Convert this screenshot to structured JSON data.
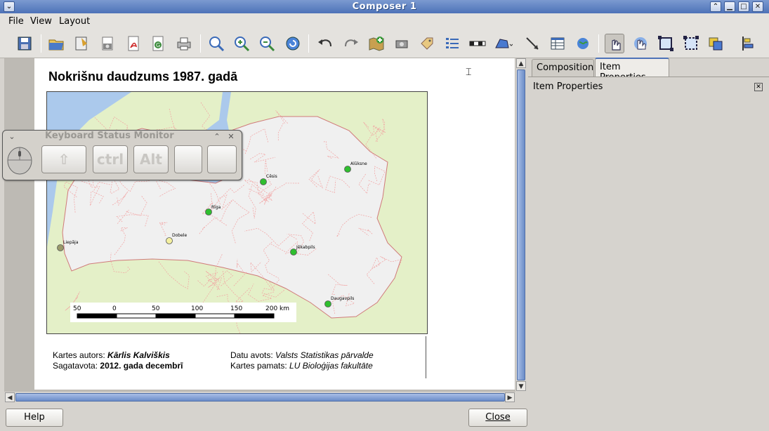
{
  "window": {
    "title": "Composer 1"
  },
  "menu": {
    "file": "File",
    "view": "View",
    "layout": "Layout"
  },
  "toolbar": {
    "icons": [
      "save-icon",
      "open-template-icon",
      "save-template-icon",
      "export-image-icon",
      "export-pdf-icon",
      "export-svg-icon",
      "print-icon",
      "zoom-full-icon",
      "zoom-in-icon",
      "zoom-out-icon",
      "refresh-icon",
      "undo-icon",
      "redo-icon",
      "add-map-icon",
      "add-image-icon",
      "add-label-icon",
      "add-legend-icon",
      "add-scalebar-icon",
      "add-shape-icon",
      "add-arrow-icon",
      "add-table-icon",
      "add-html-icon",
      "select-move-icon",
      "move-content-icon",
      "group-icon",
      "ungroup-icon",
      "raise-lower-icon",
      "align-icon"
    ]
  },
  "keyboard_monitor": {
    "title": "Keyboard Status Monitor",
    "keys": [
      "ctrl",
      "Alt"
    ]
  },
  "layout_page": {
    "title": "Nokrišnu daudzums 1987. gadā",
    "cities": [
      {
        "name": "Alūksne",
        "color": "#2fbf2f"
      },
      {
        "name": "Cēsis",
        "color": "#2fbf2f"
      },
      {
        "name": "Rīga",
        "color": "#2fbf2f"
      },
      {
        "name": "Dobele",
        "color": "#f4f0a0"
      },
      {
        "name": "Liepāja",
        "color": "#9a9a6a"
      },
      {
        "name": "Jēkabpils",
        "color": "#2fbf2f"
      },
      {
        "name": "Daugavpils",
        "color": "#2fbf2f"
      }
    ],
    "scalebar": {
      "labels": [
        "50",
        "0",
        "50",
        "100",
        "150",
        "200 km"
      ]
    },
    "credits": {
      "author_label": "Kartes autors: ",
      "author": "Kārlis Kalviškis",
      "prepared_label": "Sagatavota: ",
      "prepared": "2012. gada decembrī",
      "source_label": "Datu avots: ",
      "source": "Valsts Statistikas pārvalde",
      "basemap_label": "Kartes pamats: ",
      "basemap": "LU Bioloģijas fakultāte"
    }
  },
  "panel": {
    "tab_composition": "Composition",
    "tab_item_properties": "Item Properties",
    "header": "Item Properties"
  },
  "buttons": {
    "help": "Help",
    "close": "Close"
  },
  "colors": {
    "water": "#abc9ec",
    "land": "#f0f0f0",
    "outside": "#e4f0c8",
    "borders": "#f08a8a",
    "accent": "#4d72b8"
  }
}
